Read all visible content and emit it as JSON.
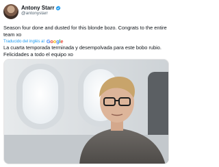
{
  "tweet": {
    "display_name": "Antony Starr",
    "handle": "@antonystarr",
    "text": "Season four done and dusted for this blonde bozo. Congrats to the entire team xo",
    "translate_label": "Traducido del inglés al",
    "translate_provider": "Google",
    "translated_text": "La cuarta temporada terminada y desempolvada para este bobo rubio. Felicidades a todo el equipo xo",
    "media": {
      "description": "selfie-on-airplane"
    }
  },
  "colors": {
    "link": "#1d9bf0",
    "verified": "#1d9bf0",
    "secondary_text": "#536471"
  }
}
